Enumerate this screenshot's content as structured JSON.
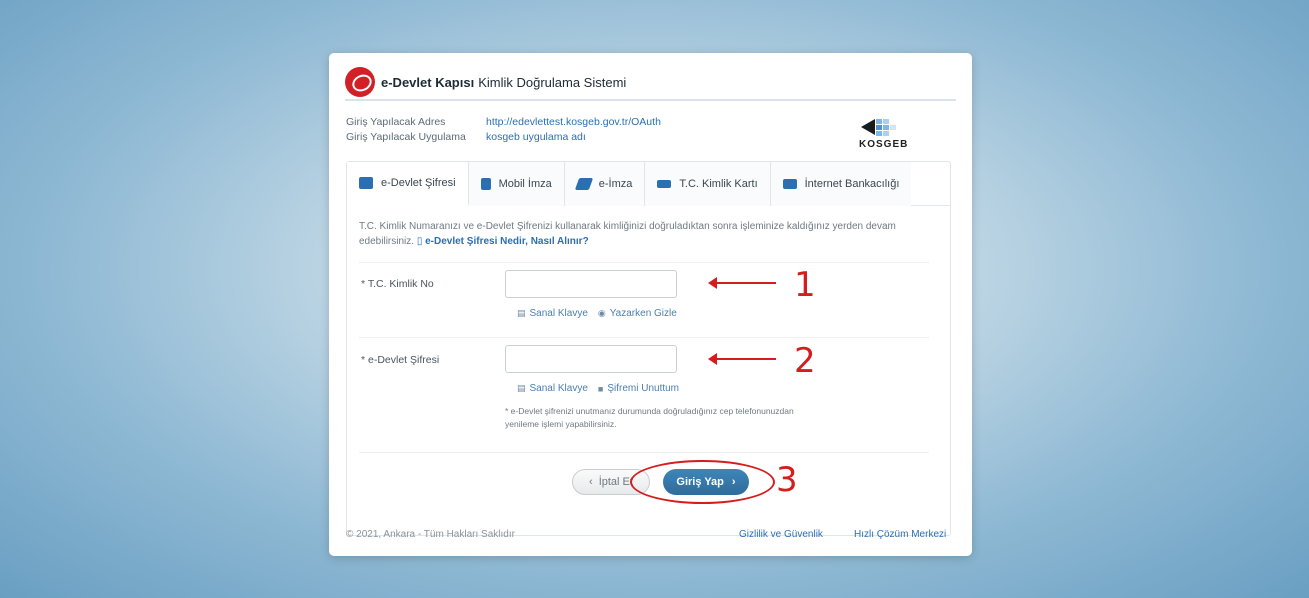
{
  "header": {
    "brand": "e-Devlet Kapısı",
    "subtitle": "Kimlik Doğrulama Sistemi"
  },
  "info": {
    "address_label": "Giriş Yapılacak Adres",
    "address_value": "http://edevlettest.kosgeb.gov.tr/OAuth",
    "app_label": "Giriş Yapılacak Uygulama",
    "app_value": "kosgeb uygulama adı"
  },
  "partner_logo": {
    "text": "KOSGEB"
  },
  "tabs": [
    {
      "label": "e-Devlet Şifresi",
      "icon": "building-icon",
      "color": "#2b6fb3"
    },
    {
      "label": "Mobil İmza",
      "icon": "mobile-icon",
      "color": "#2b6fb3"
    },
    {
      "label": "e-İmza",
      "icon": "pen-icon",
      "color": "#2b6fb3"
    },
    {
      "label": "T.C. Kimlik Kartı",
      "icon": "id-card-icon",
      "color": "#2b6fb3"
    },
    {
      "label": "İnternet Bankacılığı",
      "icon": "bank-card-icon",
      "color": "#2b6fb3"
    }
  ],
  "description": {
    "text": "T.C. Kimlik Numaranızı ve e-Devlet Şifrenizi kullanarak kimliğinizi doğruladıktan sonra işleminize kaldığınız yerden devam edebilirsiniz.",
    "link": "e-Devlet Şifresi Nedir, Nasıl Alınır?"
  },
  "form": {
    "tc_label": "* T.C. Kimlik No",
    "tc_value": "",
    "password_label": "* e-Devlet Şifresi",
    "password_value": "",
    "keyboard_label": "Sanal Klavye",
    "hide_label": "Yazarken Gizle",
    "forgot_label": "Şifremi Unuttum",
    "note": "* e-Devlet şifrenizi unutmanız durumunda doğruladığınız cep telefonunuzdan yenileme işlemi yapabilirsiniz."
  },
  "buttons": {
    "cancel": "İptal Et",
    "login": "Giriş Yap"
  },
  "annotations": [
    "1",
    "2",
    "3"
  ],
  "footer": {
    "copyright": "© 2021, Ankara - Tüm Hakları Saklıdır",
    "privacy": "Gizlilik ve Güvenlik",
    "help": "Hızlı Çözüm Merkezi"
  },
  "colors": {
    "accent": "#2b6fb3",
    "brand_red": "#d22027",
    "annotation_red": "#d41d1d"
  }
}
